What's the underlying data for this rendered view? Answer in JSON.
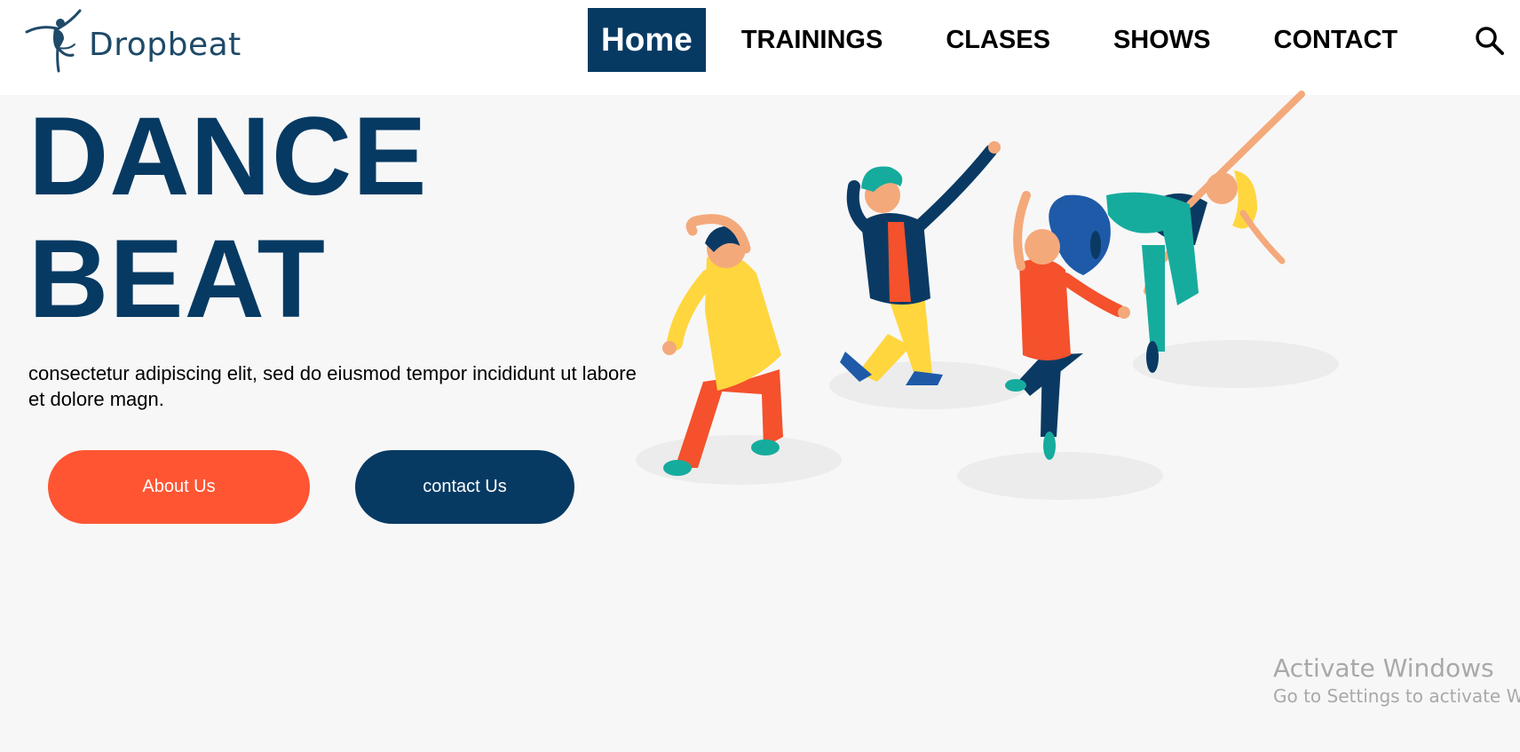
{
  "header": {
    "logo_text": "Dropbeat",
    "nav": [
      {
        "label": "Home",
        "active": true
      },
      {
        "label": "TRAININGS"
      },
      {
        "label": "CLASES"
      },
      {
        "label": "SHOWS"
      },
      {
        "label": "CONTACT"
      }
    ],
    "search_icon": "search-icon"
  },
  "hero": {
    "title_line1": "DANCE",
    "title_line2": "BEAT",
    "text": "consectetur adipiscing elit, sed do eiusmod tempor incididunt ut labore et dolore magn.",
    "about_button": "About Us",
    "contact_button": "contact Us",
    "illustration": "dancers-illustration"
  },
  "watermark": {
    "title": "Activate Windows",
    "subtitle": "Go to Settings to activate Wi"
  },
  "colors": {
    "brand_navy": "#063a63",
    "accent_orange": "#ff5533",
    "background": "#f7f7f7"
  }
}
